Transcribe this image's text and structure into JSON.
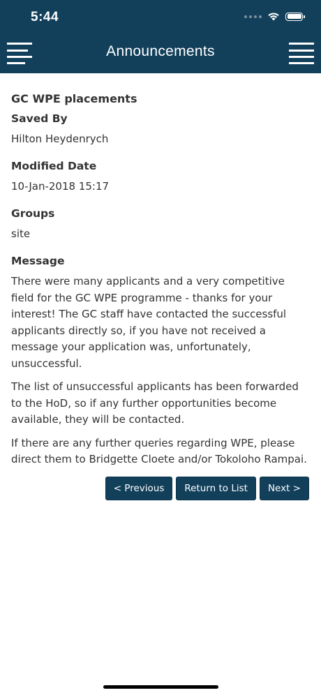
{
  "status_bar": {
    "time": "5:44"
  },
  "header": {
    "title": "Announcements",
    "background_color": "#12405b"
  },
  "announcement": {
    "title": "GC WPE placements",
    "saved_by": {
      "label": "Saved By",
      "value": "Hilton Heydenrych"
    },
    "modified_date": {
      "label": "Modified Date",
      "value": "10-Jan-2018 15:17"
    },
    "groups": {
      "label": "Groups",
      "value": "site"
    },
    "message": {
      "label": "Message",
      "paragraphs": [
        "There were many applicants and a very competitive field for the GC WPE programme - thanks for your interest!  The GC staff have contacted the successful applicants directly so, if you have not received a message your application was, unfortunately, unsuccessful.",
        "The list of unsuccessful applicants has been forwarded to the HoD, so if any further opportunities become available, they will be contacted.",
        "If there are any further queries regarding WPE, please direct them to Bridgette Cloete and/or Tokoloho Rampai."
      ]
    }
  },
  "pager": {
    "previous_label": "< Previous",
    "return_label": "Return to List",
    "next_label": "Next >"
  }
}
